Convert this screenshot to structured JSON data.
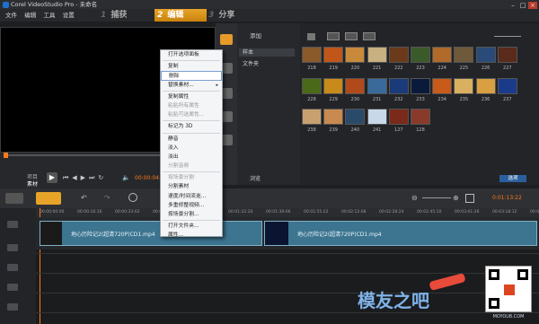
{
  "window": {
    "title": "Corel VideoStudio Pro - 未命名",
    "min": "–",
    "max": "□",
    "close": "×"
  },
  "menu": [
    "文件",
    "编辑",
    "工具",
    "设置"
  ],
  "steps": [
    {
      "num": "1",
      "label": "捕获",
      "active": false
    },
    {
      "num": "2",
      "label": "编辑",
      "active": true
    },
    {
      "num": "3",
      "label": "分享",
      "active": false
    }
  ],
  "preview": {
    "timecode": "00:00:04:15",
    "project_label": "项目",
    "clip_label": "素材"
  },
  "library": {
    "add_label": "添加",
    "folders": [
      "样本",
      "文件夹"
    ],
    "browse_label": "浏览",
    "options_label": "选项",
    "thumbs": [
      "218",
      "219",
      "220",
      "221",
      "222",
      "223",
      "224",
      "225",
      "226",
      "227",
      "228",
      "229",
      "230",
      "231",
      "232",
      "233",
      "234",
      "235",
      "236",
      "237",
      "238",
      "239",
      "240",
      "241",
      "127",
      "128"
    ]
  },
  "timeline": {
    "clip1": "地心历险记2(超清720P)CD1.mp4",
    "clip2": "地心历险记2(超清720P)CD1.mp4",
    "ticks": [
      "00:00:00:00",
      "00:00:16:16",
      "00:00:33:02",
      "00:00:49:18",
      "00:01:06:04",
      "00:01:22:20",
      "00:01:39:06",
      "00:01:55:22",
      "00:02:12:08",
      "00:02:28:24",
      "00:02:45:10",
      "00:03:01:26",
      "00:03:18:12",
      "00:03:34:28",
      "00:03:51:14"
    ],
    "duration": "0:01:13:22"
  },
  "context_menu": [
    {
      "label": "打开选项面板",
      "disabled": false
    },
    {
      "sep": true
    },
    {
      "label": "复制",
      "disabled": false
    },
    {
      "label": "删除",
      "disabled": false,
      "highlight": true
    },
    {
      "label": "替换素材...",
      "disabled": false,
      "submenu": true
    },
    {
      "sep": true
    },
    {
      "label": "复制属性",
      "disabled": false
    },
    {
      "label": "粘贴所有属性",
      "disabled": true
    },
    {
      "label": "粘贴可选属性...",
      "disabled": true
    },
    {
      "sep": true
    },
    {
      "label": "标记为 3D",
      "disabled": false
    },
    {
      "sep": true
    },
    {
      "label": "静音",
      "disabled": false
    },
    {
      "label": "淡入",
      "disabled": false
    },
    {
      "label": "淡出",
      "disabled": false
    },
    {
      "label": "分割音频",
      "disabled": true
    },
    {
      "sep": true
    },
    {
      "label": "按场景分割",
      "disabled": true
    },
    {
      "label": "分割素材",
      "disabled": false
    },
    {
      "label": "速度/时间流逝...",
      "disabled": false
    },
    {
      "label": "多重修整视频...",
      "disabled": false
    },
    {
      "label": "按场景分割...",
      "disabled": false
    },
    {
      "sep": true
    },
    {
      "label": "打开文件夹...",
      "disabled": false
    },
    {
      "label": "属性...",
      "disabled": false
    }
  ],
  "watermark": {
    "text": "模友之吧",
    "url": "MOYOU8.COM"
  }
}
